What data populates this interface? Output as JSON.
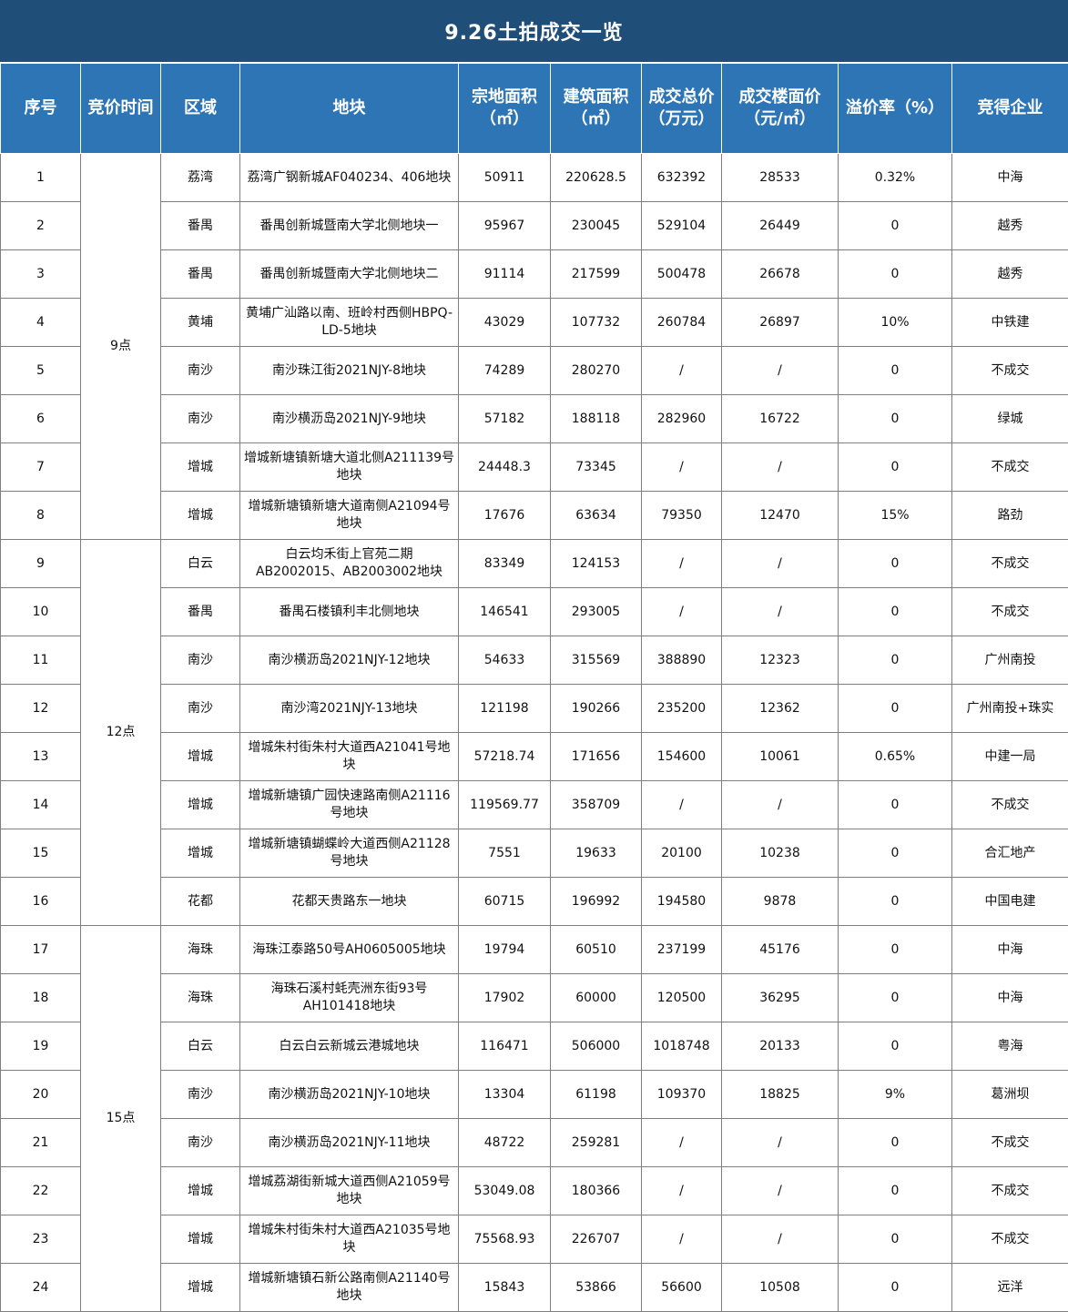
{
  "title": "9.26土拍成交一览",
  "headers": {
    "seq": "序号",
    "time": "竞价时间",
    "area": "区域",
    "plot": "地块",
    "land_area": "宗地面积（㎡）",
    "build_area": "建筑面积（㎡）",
    "total_price": "成交总价（万元）",
    "unit_price": "成交楼面价（元/㎡）",
    "premium": "溢价率（%）",
    "company": "竞得企业"
  },
  "time_groups": [
    "9点",
    "12点",
    "15点"
  ],
  "rows": [
    {
      "seq": "1",
      "area": "荔湾",
      "plot": "荔湾广钢新城AF040234、406地块",
      "land_area": "50911",
      "build_area": "220628.5",
      "total_price": "632392",
      "unit_price": "28533",
      "premium": "0.32%",
      "company": "中海"
    },
    {
      "seq": "2",
      "area": "番禺",
      "plot": "番禺创新城暨南大学北侧地块一",
      "land_area": "95967",
      "build_area": "230045",
      "total_price": "529104",
      "unit_price": "26449",
      "premium": "0",
      "company": "越秀"
    },
    {
      "seq": "3",
      "area": "番禺",
      "plot": "番禺创新城暨南大学北侧地块二",
      "land_area": "91114",
      "build_area": "217599",
      "total_price": "500478",
      "unit_price": "26678",
      "premium": "0",
      "company": "越秀"
    },
    {
      "seq": "4",
      "area": "黄埔",
      "plot": "黄埔广汕路以南、班岭村西侧HBPQ-LD-5地块",
      "land_area": "43029",
      "build_area": "107732",
      "total_price": "260784",
      "unit_price": "26897",
      "premium": "10%",
      "company": "中铁建"
    },
    {
      "seq": "5",
      "area": "南沙",
      "plot": "南沙珠江街2021NJY-8地块",
      "land_area": "74289",
      "build_area": "280270",
      "total_price": "/",
      "unit_price": "/",
      "premium": "0",
      "company": "不成交"
    },
    {
      "seq": "6",
      "area": "南沙",
      "plot": "南沙横沥岛2021NJY-9地块",
      "land_area": "57182",
      "build_area": "188118",
      "total_price": "282960",
      "unit_price": "16722",
      "premium": "0",
      "company": "绿城"
    },
    {
      "seq": "7",
      "area": "增城",
      "plot": "增城新塘镇新塘大道北侧A211139号地块",
      "land_area": "24448.3",
      "build_area": "73345",
      "total_price": "/",
      "unit_price": "/",
      "premium": "0",
      "company": "不成交"
    },
    {
      "seq": "8",
      "area": "增城",
      "plot": "增城新塘镇新塘大道南侧A21094号地块",
      "land_area": "17676",
      "build_area": "63634",
      "total_price": "79350",
      "unit_price": "12470",
      "premium": "15%",
      "company": "路劲"
    },
    {
      "seq": "9",
      "area": "白云",
      "plot": "白云均禾街上官苑二期AB2002015、AB2003002地块",
      "land_area": "83349",
      "build_area": "124153",
      "total_price": "/",
      "unit_price": "/",
      "premium": "0",
      "company": "不成交"
    },
    {
      "seq": "10",
      "area": "番禺",
      "plot": "番禺石楼镇利丰北侧地块",
      "land_area": "146541",
      "build_area": "293005",
      "total_price": "/",
      "unit_price": "/",
      "premium": "0",
      "company": "不成交"
    },
    {
      "seq": "11",
      "area": "南沙",
      "plot": "南沙横沥岛2021NJY-12地块",
      "land_area": "54633",
      "build_area": "315569",
      "total_price": "388890",
      "unit_price": "12323",
      "premium": "0",
      "company": "广州南投"
    },
    {
      "seq": "12",
      "area": "南沙",
      "plot": "南沙湾2021NJY-13地块",
      "land_area": "121198",
      "build_area": "190266",
      "total_price": "235200",
      "unit_price": "12362",
      "premium": "0",
      "company": "广州南投+珠实"
    },
    {
      "seq": "13",
      "area": "增城",
      "plot": "增城朱村街朱村大道西A21041号地块",
      "land_area": "57218.74",
      "build_area": "171656",
      "total_price": "154600",
      "unit_price": "10061",
      "premium": "0.65%",
      "company": "中建一局"
    },
    {
      "seq": "14",
      "area": "增城",
      "plot": "增城新塘镇广园快速路南侧A21116号地块",
      "land_area": "119569.77",
      "build_area": "358709",
      "total_price": "/",
      "unit_price": "/",
      "premium": "0",
      "company": "不成交"
    },
    {
      "seq": "15",
      "area": "增城",
      "plot": "增城新塘镇蝴蝶岭大道西侧A21128号地块",
      "land_area": "7551",
      "build_area": "19633",
      "total_price": "20100",
      "unit_price": "10238",
      "premium": "0",
      "company": "合汇地产"
    },
    {
      "seq": "16",
      "area": "花都",
      "plot": "花都天贵路东一地块",
      "land_area": "60715",
      "build_area": "196992",
      "total_price": "194580",
      "unit_price": "9878",
      "premium": "0",
      "company": "中国电建"
    },
    {
      "seq": "17",
      "area": "海珠",
      "plot": "海珠江泰路50号AH0605005地块",
      "land_area": "19794",
      "build_area": "60510",
      "total_price": "237199",
      "unit_price": "45176",
      "premium": "0",
      "company": "中海"
    },
    {
      "seq": "18",
      "area": "海珠",
      "plot": "海珠石溪村蚝壳洲东街93号AH101418地块",
      "land_area": "17902",
      "build_area": "60000",
      "total_price": "120500",
      "unit_price": "36295",
      "premium": "0",
      "company": "中海"
    },
    {
      "seq": "19",
      "area": "白云",
      "plot": "白云白云新城云港城地块",
      "land_area": "116471",
      "build_area": "506000",
      "total_price": "1018748",
      "unit_price": "20133",
      "premium": "0",
      "company": "粤海"
    },
    {
      "seq": "20",
      "area": "南沙",
      "plot": "南沙横沥岛2021NJY-10地块",
      "land_area": "13304",
      "build_area": "61198",
      "total_price": "109370",
      "unit_price": "18825",
      "premium": "9%",
      "company": "葛洲坝"
    },
    {
      "seq": "21",
      "area": "南沙",
      "plot": "南沙横沥岛2021NJY-11地块",
      "land_area": "48722",
      "build_area": "259281",
      "total_price": "/",
      "unit_price": "/",
      "premium": "0",
      "company": "不成交"
    },
    {
      "seq": "22",
      "area": "增城",
      "plot": "增城荔湖街新城大道西侧A21059号地块",
      "land_area": "53049.08",
      "build_area": "180366",
      "total_price": "/",
      "unit_price": "/",
      "premium": "0",
      "company": "不成交"
    },
    {
      "seq": "23",
      "area": "增城",
      "plot": "增城朱村街朱村大道西A21035号地块",
      "land_area": "75568.93",
      "build_area": "226707",
      "total_price": "/",
      "unit_price": "/",
      "premium": "0",
      "company": "不成交"
    },
    {
      "seq": "24",
      "area": "增城",
      "plot": "增城新塘镇石新公路南侧A21140号地块",
      "land_area": "15843",
      "build_area": "53866",
      "total_price": "56600",
      "unit_price": "10508",
      "premium": "0",
      "company": "远洋"
    }
  ]
}
